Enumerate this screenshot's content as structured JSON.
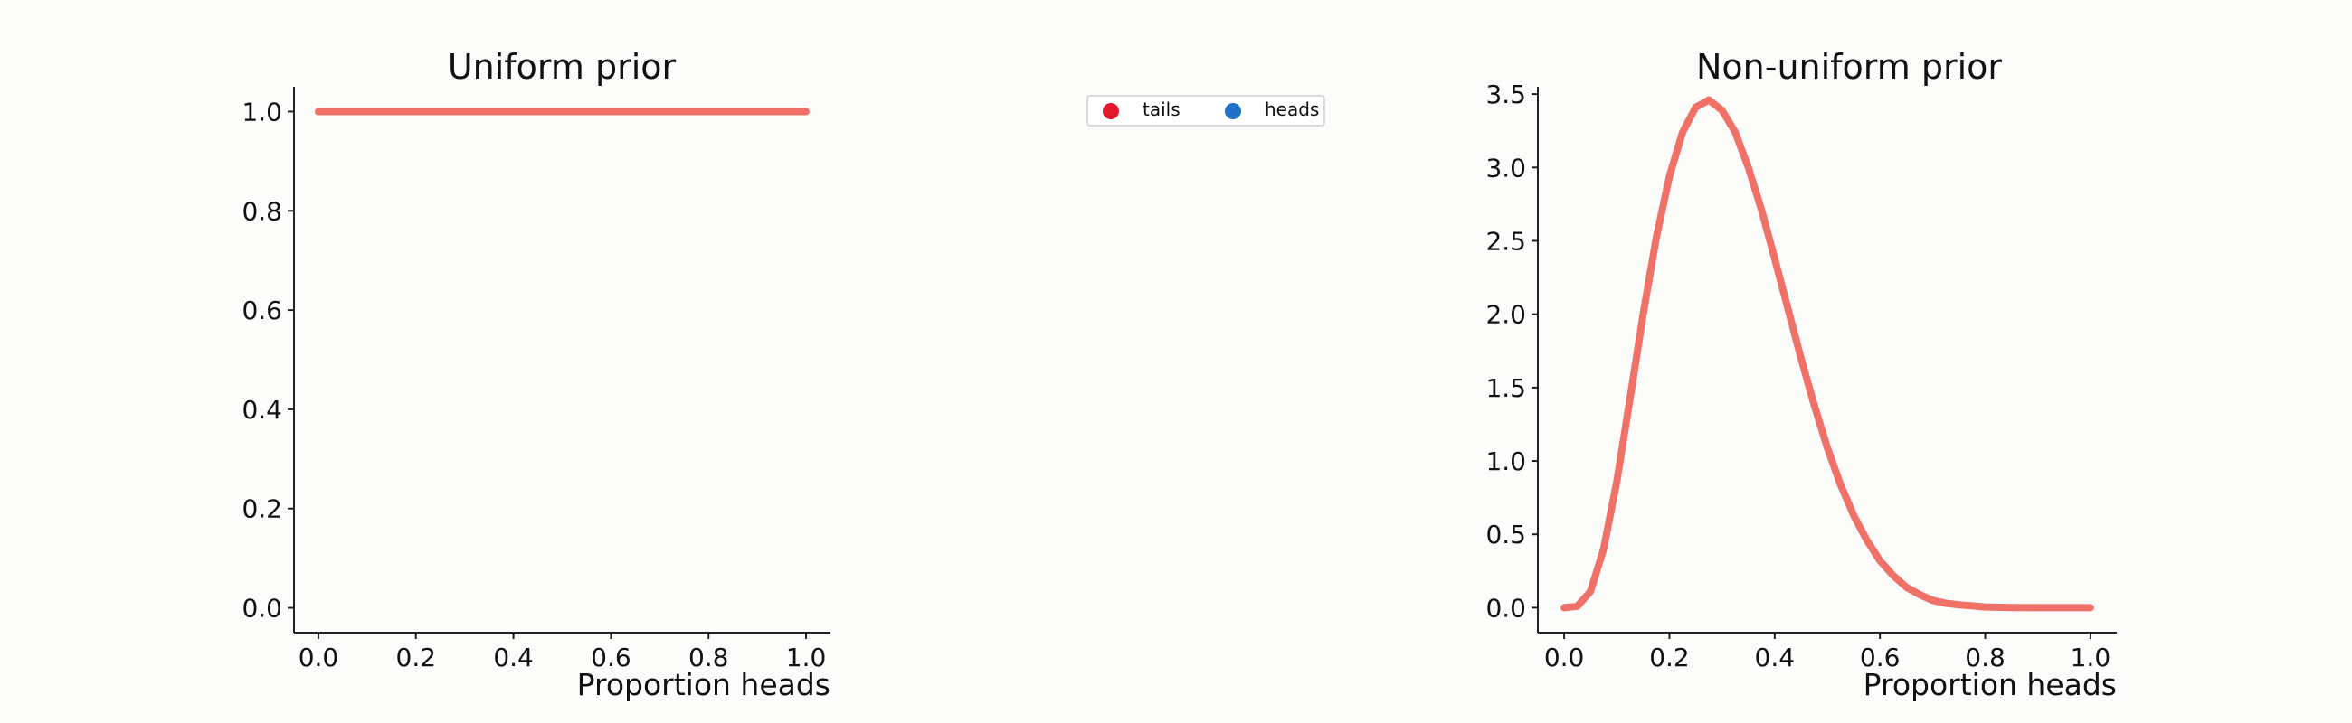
{
  "chart_data": [
    {
      "type": "line",
      "title": "Uniform prior",
      "xlabel": "Proportion heads",
      "ylabel": "",
      "xlim": [
        -0.05,
        1.05
      ],
      "ylim": [
        -0.05,
        1.05
      ],
      "xticks": [
        "0.0",
        "0.2",
        "0.4",
        "0.6",
        "0.8",
        "1.0"
      ],
      "yticks": [
        "0.0",
        "0.2",
        "0.4",
        "0.6",
        "0.8",
        "1.0"
      ],
      "grid": false,
      "series": [
        {
          "color": "#ef7167",
          "x": [
            0.0,
            0.1,
            0.2,
            0.3,
            0.4,
            0.5,
            0.6,
            0.7,
            0.8,
            0.9,
            1.0
          ],
          "y": [
            1.0,
            1.0,
            1.0,
            1.0,
            1.0,
            1.0,
            1.0,
            1.0,
            1.0,
            1.0,
            1.0
          ]
        }
      ]
    },
    {
      "type": "line",
      "title": "Non-uniform prior",
      "xlabel": "Proportion heads",
      "ylabel": "",
      "xlim": [
        -0.05,
        1.05
      ],
      "ylim": [
        -0.17,
        3.55
      ],
      "xticks": [
        "0.0",
        "0.2",
        "0.4",
        "0.6",
        "0.8",
        "1.0"
      ],
      "yticks": [
        "0.0",
        "0.5",
        "1.0",
        "1.5",
        "2.0",
        "2.5",
        "3.0",
        "3.5"
      ],
      "grid": false,
      "series": [
        {
          "color": "#ef7167",
          "x": [
            0.0,
            0.025,
            0.05,
            0.075,
            0.1,
            0.125,
            0.15,
            0.175,
            0.2,
            0.225,
            0.25,
            0.275,
            0.3,
            0.325,
            0.35,
            0.375,
            0.4,
            0.425,
            0.45,
            0.475,
            0.5,
            0.525,
            0.55,
            0.575,
            0.6,
            0.625,
            0.65,
            0.675,
            0.7,
            0.725,
            0.75,
            0.8,
            0.85,
            0.9,
            0.95,
            1.0
          ],
          "y": [
            0.0,
            0.01,
            0.11,
            0.4,
            0.86,
            1.42,
            2.0,
            2.52,
            2.94,
            3.24,
            3.41,
            3.46,
            3.39,
            3.24,
            3.0,
            2.71,
            2.38,
            2.04,
            1.7,
            1.38,
            1.09,
            0.84,
            0.63,
            0.46,
            0.32,
            0.22,
            0.14,
            0.09,
            0.05,
            0.03,
            0.02,
            0.005,
            0.001,
            0.0,
            0.0,
            0.0
          ]
        }
      ]
    }
  ],
  "legend": {
    "placement": "top-center",
    "entries": [
      {
        "label": "tails",
        "color": "#e3182d"
      },
      {
        "label": "heads",
        "color": "#1f6fc5"
      }
    ]
  }
}
